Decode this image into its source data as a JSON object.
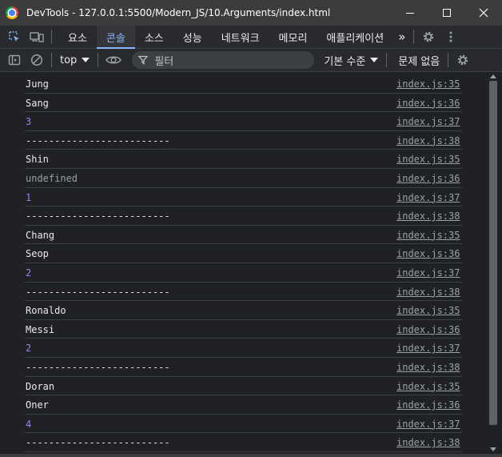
{
  "window": {
    "title": "DevTools - 127.0.0.1:5500/Modern_JS/10.Arguments/index.html"
  },
  "tabs": [
    {
      "label": "요소"
    },
    {
      "label": "콘솔"
    },
    {
      "label": "소스"
    },
    {
      "label": "성능"
    },
    {
      "label": "네트워크"
    },
    {
      "label": "메모리"
    },
    {
      "label": "애플리케이션"
    }
  ],
  "tab_overflow": "»",
  "toolbar": {
    "context": "top",
    "filter_placeholder": "필터",
    "levels": "기본 수준",
    "issues": "문제 없음"
  },
  "console_rows": [
    {
      "text": "Jung",
      "type": "string",
      "source": "index.js:35"
    },
    {
      "text": "Sang",
      "type": "string",
      "source": "index.js:36"
    },
    {
      "text": "3",
      "type": "number",
      "source": "index.js:37"
    },
    {
      "text": "-------------------------",
      "type": "string",
      "source": "index.js:38"
    },
    {
      "text": "Shin",
      "type": "string",
      "source": "index.js:35"
    },
    {
      "text": "undefined",
      "type": "undefined",
      "source": "index.js:36"
    },
    {
      "text": "1",
      "type": "number",
      "source": "index.js:37"
    },
    {
      "text": "-------------------------",
      "type": "string",
      "source": "index.js:38"
    },
    {
      "text": "Chang",
      "type": "string",
      "source": "index.js:35"
    },
    {
      "text": "Seop",
      "type": "string",
      "source": "index.js:36"
    },
    {
      "text": "2",
      "type": "number",
      "source": "index.js:37"
    },
    {
      "text": "-------------------------",
      "type": "string",
      "source": "index.js:38"
    },
    {
      "text": "Ronaldo",
      "type": "string",
      "source": "index.js:35"
    },
    {
      "text": "Messi",
      "type": "string",
      "source": "index.js:36"
    },
    {
      "text": "2",
      "type": "number",
      "source": "index.js:37"
    },
    {
      "text": "-------------------------",
      "type": "string",
      "source": "index.js:38"
    },
    {
      "text": "Doran",
      "type": "string",
      "source": "index.js:35"
    },
    {
      "text": "Oner",
      "type": "string",
      "source": "index.js:36"
    },
    {
      "text": "4",
      "type": "number",
      "source": "index.js:37"
    },
    {
      "text": "-------------------------",
      "type": "string",
      "source": "index.js:38"
    }
  ],
  "colors": {
    "accent": "#8ab4f8",
    "number": "#9980ff",
    "background": "#202124"
  }
}
